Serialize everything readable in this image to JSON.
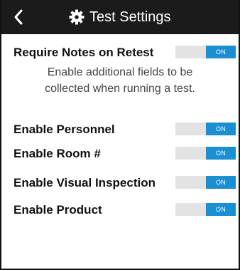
{
  "header": {
    "title": "Test Settings",
    "back_icon": "chevron-left-icon",
    "settings_icon": "gear-icon",
    "background": "#1b1b1b"
  },
  "settings": {
    "require_notes": {
      "label": "Require Notes on Retest",
      "state": "ON"
    },
    "note_line1": "Enable additional fields to be",
    "note_line2": "collected when running a test.",
    "items": [
      {
        "label": "Enable Personnel",
        "state": "ON"
      },
      {
        "label": "Enable Room #",
        "state": "ON"
      },
      {
        "label": "Enable Visual Inspection",
        "state": "ON"
      },
      {
        "label": "Enable Product",
        "state": "ON"
      }
    ]
  },
  "colors": {
    "accent": "#1a8fd2",
    "toggle_track": "#e3e3e3"
  }
}
